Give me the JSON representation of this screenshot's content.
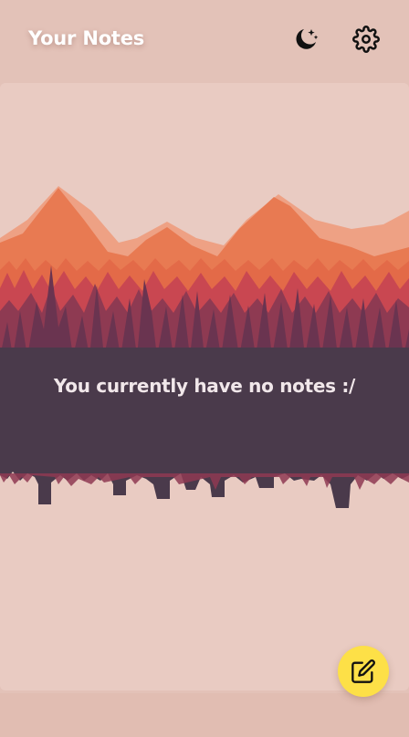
{
  "header": {
    "title": "Your Notes",
    "theme_toggle_icon": "moon-stars-icon",
    "settings_icon": "gear-icon"
  },
  "main": {
    "empty_message": "You currently have no notes :/",
    "illustration": "mountain-forest-landscape"
  },
  "fab": {
    "icon": "edit-note-icon",
    "color": "#fde047"
  },
  "colors": {
    "background": "#e3c2b8",
    "card": "#e9cbc2",
    "title_text": "#ffffff",
    "forest_dark": "#4a3a4b"
  }
}
